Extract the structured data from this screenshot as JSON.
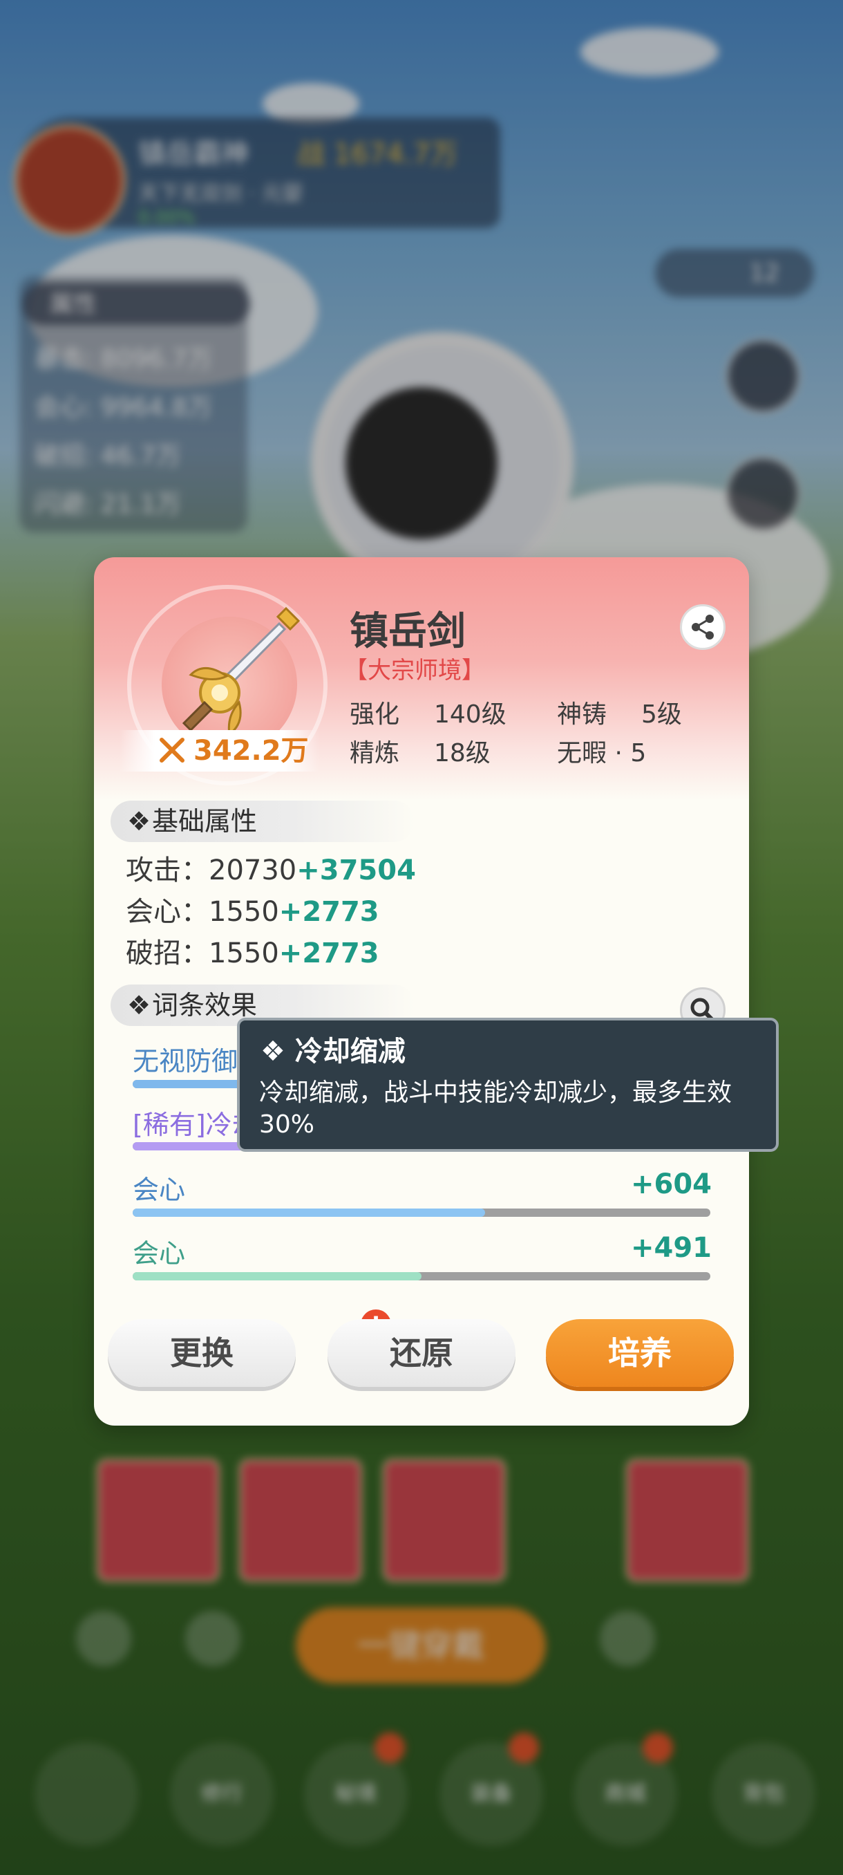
{
  "background": {
    "player_name": "镇岳霸神",
    "player_power": "战 1674.7万",
    "player_sub": "天下无双剑 · 元婴",
    "player_pct": "0.00%",
    "stats_tab": "属性",
    "stat_lines": [
      "暴击: 8096.7万",
      "会心: 9964.8万",
      "破招: 46.7万",
      "闪避: 21.1万"
    ],
    "counter": "12",
    "one_click": "一键穿戴",
    "nav": [
      "修行",
      "秘境",
      "装备",
      "商城",
      "背包"
    ]
  },
  "card": {
    "item_name": "镇岳剑",
    "rank": "【大宗师境】",
    "power": "342.2万",
    "attrs": [
      {
        "label": "强化",
        "value": "140级"
      },
      {
        "label": "神铸",
        "value": "5级"
      },
      {
        "label": "精炼",
        "value": "18级"
      },
      {
        "label": "无暇 · 5",
        "value": ""
      }
    ],
    "basic_section": "基础属性",
    "basic_stats": [
      {
        "label": "攻击：",
        "base": "20730",
        "bonus": "+37504"
      },
      {
        "label": "会心：",
        "base": "1550",
        "bonus": "+2773"
      },
      {
        "label": "破招：",
        "base": "1550",
        "bonus": "+2773"
      }
    ],
    "effects_section": "词条效果",
    "effects": [
      {
        "label": "无视防御",
        "value": "",
        "fill": 0.2,
        "color": "#7fb8ec",
        "label_color": "#4a86c4"
      },
      {
        "label": "[稀有]冷却缩减",
        "value": "",
        "fill": 0.2,
        "color": "#b49cf2",
        "label_color": "#8b6de0"
      },
      {
        "label": "会心",
        "value": "+604",
        "fill": 0.61,
        "color": "#8cc4f2",
        "label_color": "#4a86c4"
      },
      {
        "label": "会心",
        "value": "+491",
        "fill": 0.5,
        "color": "#9ee0c4",
        "label_color": "#3f9f8a"
      }
    ],
    "buttons": {
      "replace": "更换",
      "restore": "还原",
      "cultivate": "培养"
    },
    "alert": "!"
  },
  "tooltip": {
    "title": "冷却缩减",
    "body": "冷却缩减，战斗中技能冷却减少，最多生效30%"
  }
}
